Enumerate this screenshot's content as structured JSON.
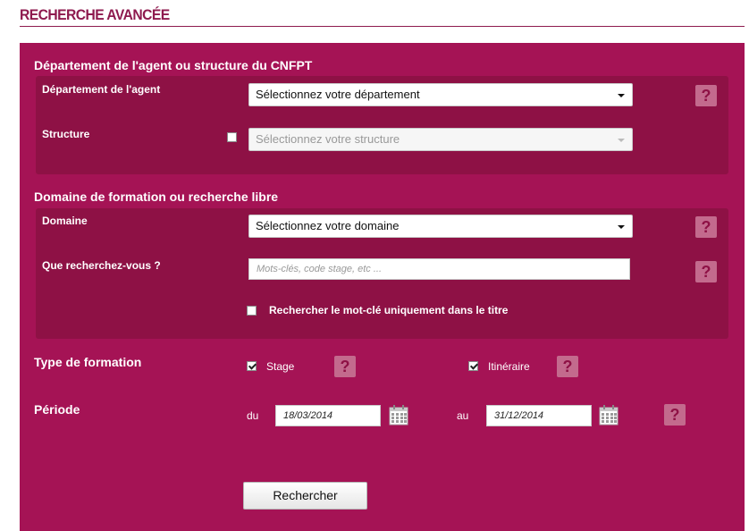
{
  "page": {
    "title": "RECHERCHE AVANCÉE"
  },
  "section1": {
    "title": "Département de l'agent ou structure du CNFPT",
    "departement_label": "Département de l'agent",
    "departement_value": "Sélectionnez votre département",
    "structure_label": "Structure",
    "structure_value": "Sélectionnez votre structure"
  },
  "section2": {
    "title": "Domaine de formation ou recherche libre",
    "domaine_label": "Domaine",
    "domaine_value": "Sélectionnez votre domaine",
    "query_label": "Que recherchez-vous ?",
    "query_placeholder": "Mots-clés, code stage, etc ...",
    "title_only_label": "Rechercher le mot-clé uniquement dans le titre"
  },
  "type": {
    "label": "Type de formation",
    "stage_label": "Stage",
    "itineraire_label": "Itinéraire"
  },
  "periode": {
    "label": "Période",
    "du_label": "du",
    "du_value": "18/03/2014",
    "au_label": "au",
    "au_value": "31/12/2014"
  },
  "help_glyph": "?",
  "search_button": "Rechercher",
  "colors": {
    "panel": "#a51355",
    "box": "#8e1145",
    "title": "#8e1a4e",
    "help": "#c36a8d"
  },
  "icons": [
    "help-icon",
    "calendar-icon",
    "dropdown-arrow-icon",
    "checkbox-icon"
  ]
}
